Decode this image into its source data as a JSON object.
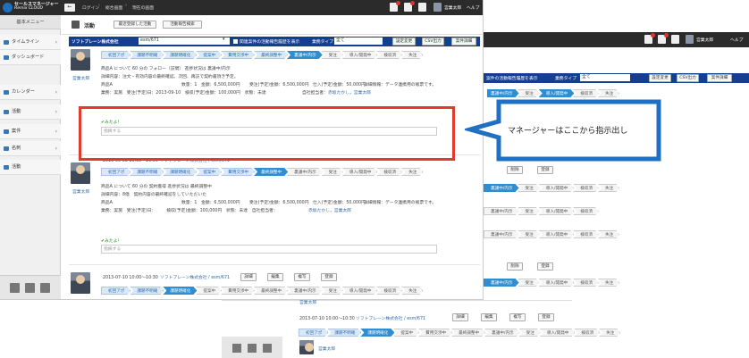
{
  "app": {
    "logo_title": "セールスマネージャー",
    "logo_sub": "Remix CLOUD",
    "breadcrumbs": [
      "ログイン",
      "総合画面",
      "現在の画面"
    ],
    "user_name": "営業太郎",
    "help_label": "ヘルプ"
  },
  "sidebar": {
    "header": "基本メニュー",
    "items": [
      {
        "label": "タイムライン"
      },
      {
        "label": "ダッシュボード"
      },
      {
        "label": "カレンダー"
      },
      {
        "label": "活動"
      },
      {
        "label": "案件"
      },
      {
        "label": "名刺"
      },
      {
        "label": "活動"
      }
    ]
  },
  "page": {
    "title": "活動",
    "tab_recent": "最近登録した活動",
    "tab_search": "活動報告検索",
    "company_label": "ソフトブレーン株式会社",
    "company_select": "esm/671",
    "history_checkbox_label": "関連案件の活動報告履歴を表示",
    "type_label": "業務タイプ",
    "type_value": "全て",
    "btn_settings": "設定変更",
    "btn_csv": "CSV出力",
    "btn_print": "案件詳細"
  },
  "stages": [
    "初回アポ",
    "課題不明確",
    "課題明確化",
    "提案中",
    "費用交渉中",
    "最終調整中",
    "裏議中/内示",
    "受注",
    "導入/開発中",
    "検収済",
    "失注"
  ],
  "record1": {
    "avatar_name": "営業太郎",
    "line1": "商品A について 60 分の フォロー（訪問） 進捗状況は 裏議中/内示",
    "line2": "詳細内容：注文・有効内容の最終確認。次回、再訪で契約書頂き予定。",
    "product": "商品A",
    "qty": "数量：1",
    "amount": "金額：6,500,000円",
    "order_amount": "受注(予定)金額：6,500,000円",
    "cost": "仕入(予定)金額：50,000円",
    "detail_info": "詳細情報：データ連携用の帳票です。",
    "dates": "業務：実施　受注(予定)日：2013-09-10　検収(予定)金額：100,000円　状態：未達",
    "person_label": "自社担当者：",
    "person": "赤坂たかし，営業太郎",
    "comment_label": "✔みたよ！",
    "comment_placeholder": "指摘する"
  },
  "record2": {
    "avatar_name": "営業太郎",
    "meta": "2013-09-02 15:00〜16:00",
    "company_link": "ソフトブレーン株式会社 / esm/671",
    "line1": "商品A について 60 分の 契約獲得 進捗状況は 最終調整中",
    "line2": "詳細内容：8億　契約内容の最終確認をしていただいた",
    "product": "商品A",
    "qty": "数量：1",
    "amount": "金額：6,500,000円",
    "order_amount": "受注(予定)金額：6,500,000円",
    "cost": "仕入(予定)金額：50,000円",
    "detail_info": "詳細情報：データ連携用の帳票です。",
    "dates": "業務：実施　受注(予定)日：　　　検収(予定)金額：100,000円　状態：未達　自社担当者：",
    "person": "赤坂たかし，営業太郎",
    "comment_label": "✔みたよ！",
    "comment_placeholder": "指摘する"
  },
  "record3": {
    "meta": "2013-07-10 10:00〜10:30",
    "company_link": "ソフトブレーン株式会社 / esm/671",
    "btn_detail": "詳細",
    "btn_edit": "編集",
    "btn_copy": "複写",
    "btn_delete": "登録"
  },
  "callout": {
    "text": "マネージャーはここから指示出し"
  },
  "bg": {
    "type_label": "業務タイプ",
    "type_value": "全て",
    "history_label": "案件の活動報告履歴を表示",
    "btn_settings": "設定変更",
    "btn_csv": "CSV出力",
    "btn_print": "案件詳細",
    "btn_delete": "削除",
    "btn_register": "登録",
    "user_name": "営業太郎",
    "help_label": "ヘルプ",
    "footer_meta": "2013-07-10 10:00〜10:30",
    "footer_company": "ソフトブレーン株式会社 / esm/671",
    "footer_user": "営業太郎",
    "btn_detail": "詳細",
    "btn_edit": "編集",
    "btn_copy": "複写",
    "btn_reg": "登録"
  }
}
